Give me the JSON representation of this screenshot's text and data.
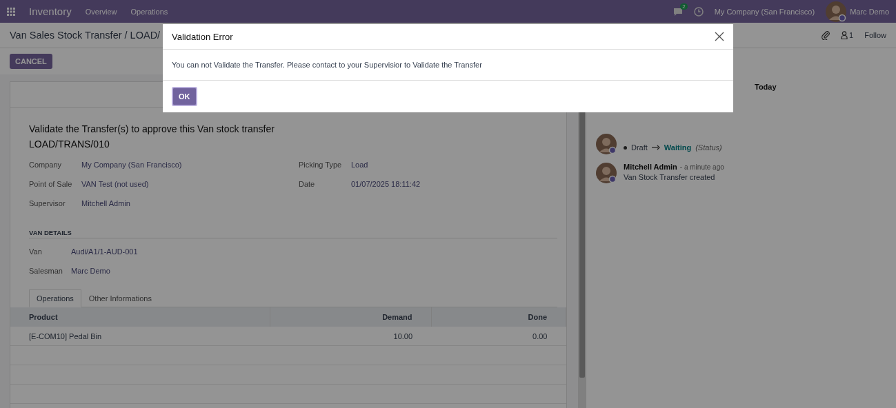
{
  "navbar": {
    "app_name": "Inventory",
    "menu": [
      "Overview",
      "Operations"
    ],
    "message_count": "2",
    "company": "My Company (San Francisco)",
    "user": "Marc Demo"
  },
  "breadcrumb": "Van Sales Stock Transfer / LOAD/",
  "toolbar": {
    "follower_count": "1",
    "follow": "Follow"
  },
  "buttons": [
    "CANCEL"
  ],
  "form": {
    "title": "Validate the Transfer(s) to approve this Van stock transfer",
    "reference": "LOAD/TRANS/010",
    "fields_left": [
      {
        "label": "Company",
        "value": "My Company (San Francisco)"
      },
      {
        "label": "Point of Sale",
        "value": "VAN Test (not used)"
      },
      {
        "label": "Supervisor",
        "value": "Mitchell Admin"
      }
    ],
    "fields_right": [
      {
        "label": "Picking Type",
        "value": "Load"
      },
      {
        "label": "Date",
        "value": "01/07/2025 18:11:42"
      }
    ],
    "section": "VAN DETAILS",
    "van_fields": [
      {
        "label": "Van",
        "value": "Audi/A1/1-AUD-001"
      },
      {
        "label": "Salesman",
        "value": "Marc Demo"
      }
    ],
    "tabs": [
      {
        "label": "Operations",
        "selected": true
      },
      {
        "label": "Other Informations",
        "selected": false
      }
    ],
    "table": {
      "columns": [
        "Product",
        "Demand",
        "Done"
      ],
      "rows": [
        [
          "[E-COM10] Pedal Bin",
          "10.00",
          "0.00"
        ]
      ]
    }
  },
  "chatter": {
    "date_label": "Today",
    "messages": [
      {
        "kind": "tracking",
        "old": "Draft",
        "new": "Waiting",
        "field": "(Status)"
      },
      {
        "kind": "note",
        "author": "Mitchell Admin",
        "time": "- a minute ago",
        "body": "Van Stock Transfer created"
      }
    ]
  },
  "dialog": {
    "title": "Validation Error",
    "message": "You can not Validate the Transfer. Please contact to your Supervisior to Validate the Transfer",
    "button": "OK"
  }
}
